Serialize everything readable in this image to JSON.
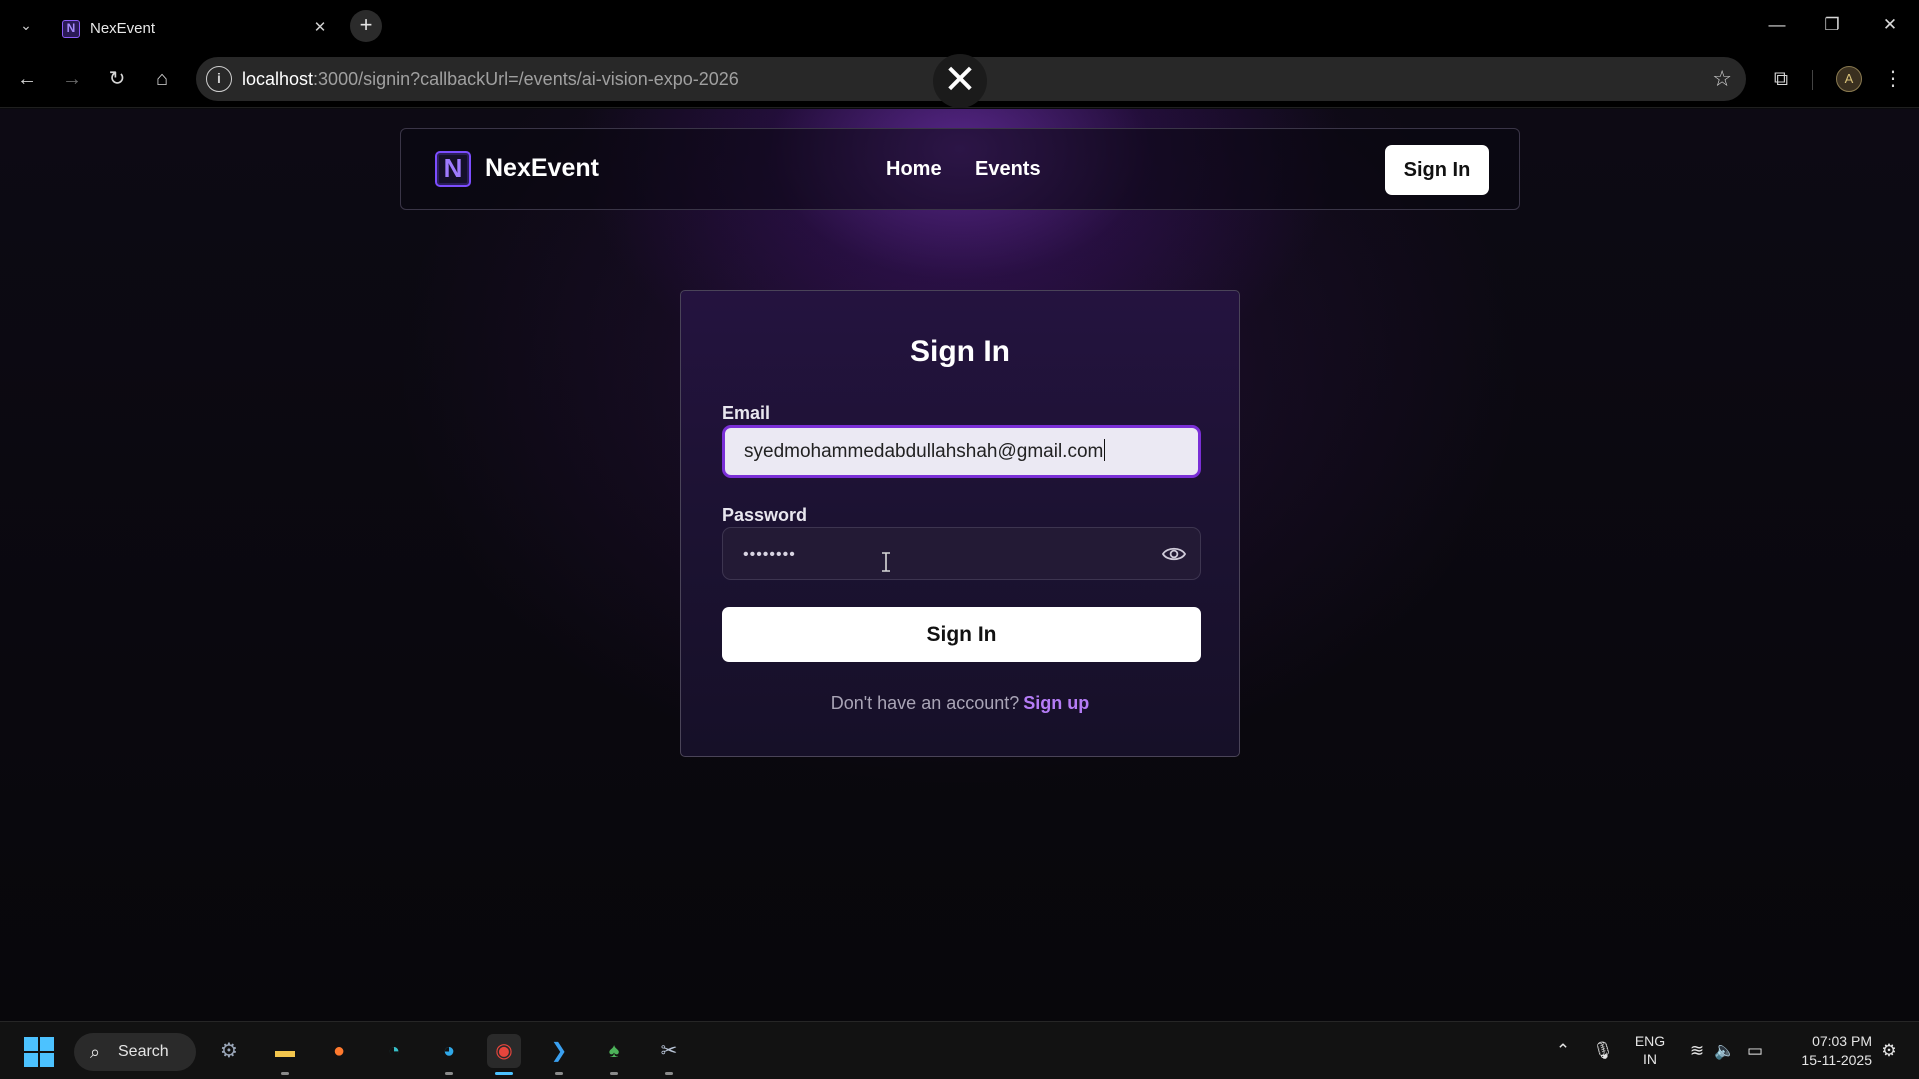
{
  "browser": {
    "tab_title": "NexEvent",
    "tab_favicon_letter": "N",
    "url_host": "localhost",
    "url_rest": ":3000/signin?callbackUrl=/events/ai-vision-expo-2026",
    "overlay_close_symbol": "✕"
  },
  "site": {
    "logo_letter": "N",
    "brand": "NexEvent",
    "nav_links": [
      "Home",
      "Events"
    ],
    "nav_signin": "Sign In"
  },
  "signin": {
    "title": "Sign In",
    "email_label": "Email",
    "email_value": "syedmohammedabdullahshah@gmail.com",
    "password_label": "Password",
    "password_mask": "••••••••",
    "submit_label": "Sign In",
    "footer_text": "Don't have an account?",
    "footer_link": "Sign up"
  },
  "taskbar": {
    "search_label": "Search",
    "lang_top": "ENG",
    "lang_bottom": "IN",
    "time": "07:03 PM",
    "date": "15-11-2025"
  },
  "colors": {
    "accent": "#7a2fd6",
    "link": "#b57cf6",
    "card_bg": "#1c1232"
  }
}
